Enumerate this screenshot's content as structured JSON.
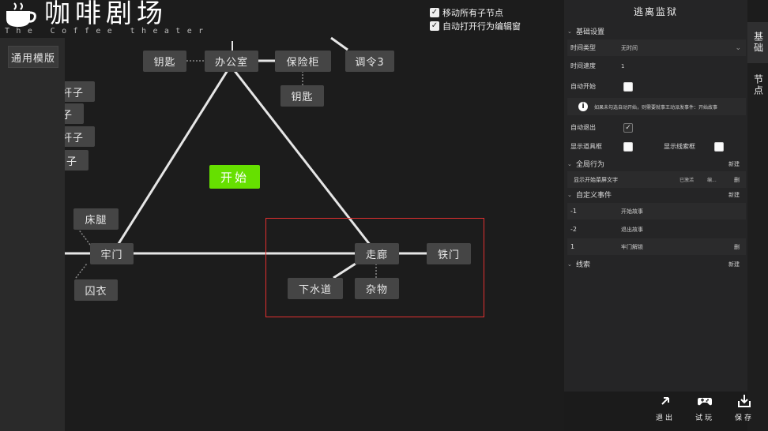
{
  "logo": {
    "title": "咖啡剧场",
    "subtitle": "The Coffee theater"
  },
  "left_panel": {
    "template_label": "通用模版"
  },
  "options": {
    "move_children": {
      "label": "移动所有子节点",
      "checked": true
    },
    "auto_open_editor": {
      "label": "自动打开行为编辑窗",
      "checked": true
    }
  },
  "nodes": {
    "key_top": "钥匙",
    "office": "办公室",
    "safe": "保险柜",
    "order3": "调令3",
    "key_mid": "钥匙",
    "start": "开始",
    "rod1": "杆子",
    "child1": "子",
    "rod2": "杆子",
    "child2": "子",
    "bed_leg": "床腿",
    "cell_door": "牢门",
    "prison_clothes": "囚衣",
    "corridor": "走廊",
    "iron_door": "铁门",
    "sewer": "下水道",
    "misc": "杂物"
  },
  "panel": {
    "title": "逃离监狱",
    "basic": {
      "section": "基础设置",
      "time_type_label": "时间类型",
      "time_type_value": "无时间",
      "time_speed_label": "时间速度",
      "time_speed_value": "1",
      "auto_start_label": "自动开始",
      "auto_start_checked": false,
      "info_text": "如果未勾选自动开始，则需要就事王动派发事件：开始故事",
      "auto_exit_label": "自动退出",
      "auto_exit_checked": true,
      "show_prop_label": "显示道具框",
      "show_clue_label": "显示线索框"
    },
    "global": {
      "section": "全局行为",
      "new_label": "新建",
      "item_text": "显示开始菜屏文字",
      "item_status": "已激活",
      "item_edit": "编...",
      "item_delete": "删"
    },
    "custom_events": {
      "section": "自定义事件",
      "new_label": "新建",
      "rows": [
        {
          "id": "-1",
          "name": "开始故事",
          "action": ""
        },
        {
          "id": "-2",
          "name": "退出故事",
          "action": ""
        },
        {
          "id": "1",
          "name": "牢门解锁",
          "action": "删"
        }
      ]
    },
    "clues": {
      "section": "线索",
      "new_label": "新建"
    }
  },
  "tabs": [
    {
      "label": "基础",
      "active": true
    },
    {
      "label": "节点",
      "active": false
    }
  ],
  "bottom": {
    "exit_label": "退出",
    "play_label": "试玩",
    "save_label": "保存"
  },
  "colors": {
    "start_node": "#66e000",
    "selection": "#e23030",
    "node_bg": "#454545"
  }
}
